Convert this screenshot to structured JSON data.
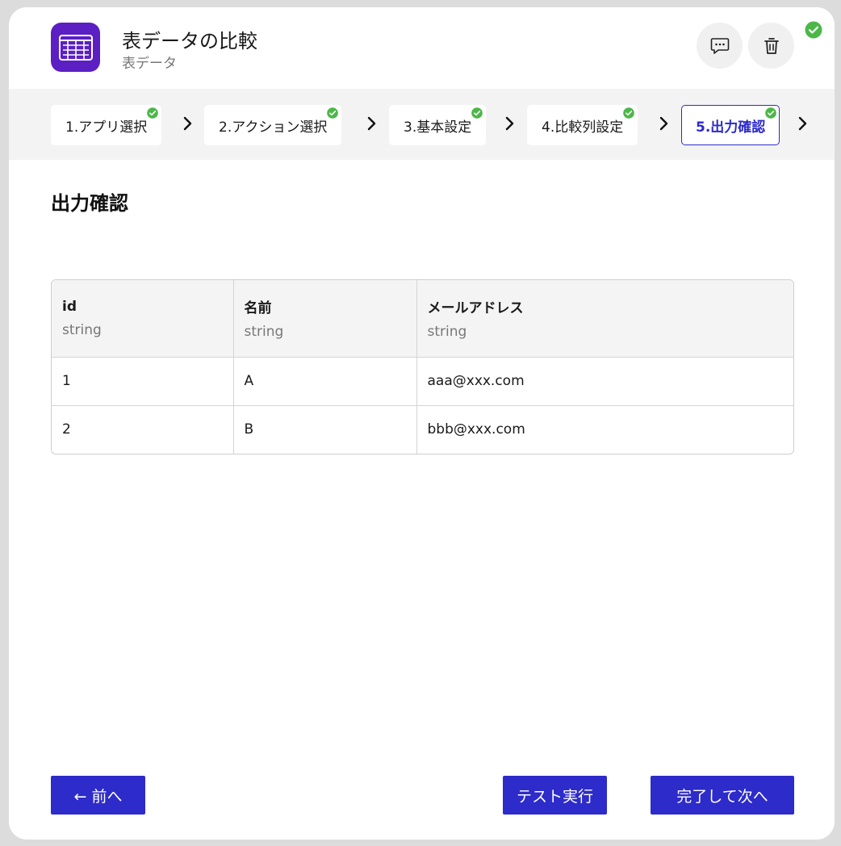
{
  "header": {
    "title": "表データの比較",
    "subtitle": "表データ",
    "icon": "table-app-icon",
    "accent": "#5b1fc4"
  },
  "status": {
    "icon": "check-circle-icon",
    "color": "#4cb748"
  },
  "steps": [
    {
      "label": "1.アプリ選択",
      "completed": true,
      "active": false
    },
    {
      "label": "2.アクション選択",
      "completed": true,
      "active": false
    },
    {
      "label": "3.基本設定",
      "completed": true,
      "active": false
    },
    {
      "label": "4.比較列設定",
      "completed": true,
      "active": false
    },
    {
      "label": "5.出力確認",
      "completed": true,
      "active": true
    }
  ],
  "section": {
    "title": "出力確認"
  },
  "table": {
    "columns": [
      {
        "name": "id",
        "type": "string"
      },
      {
        "name": "名前",
        "type": "string"
      },
      {
        "name": "メールアドレス",
        "type": "string"
      }
    ],
    "rows": [
      [
        "1",
        "A",
        "aaa@xxx.com"
      ],
      [
        "2",
        "B",
        "bbb@xxx.com"
      ]
    ]
  },
  "footer": {
    "prev_label": "← 前へ",
    "test_label": "テスト実行",
    "next_label": "完了して次へ"
  },
  "colors": {
    "primary": "#2d2bc9",
    "check": "#4cb748"
  }
}
